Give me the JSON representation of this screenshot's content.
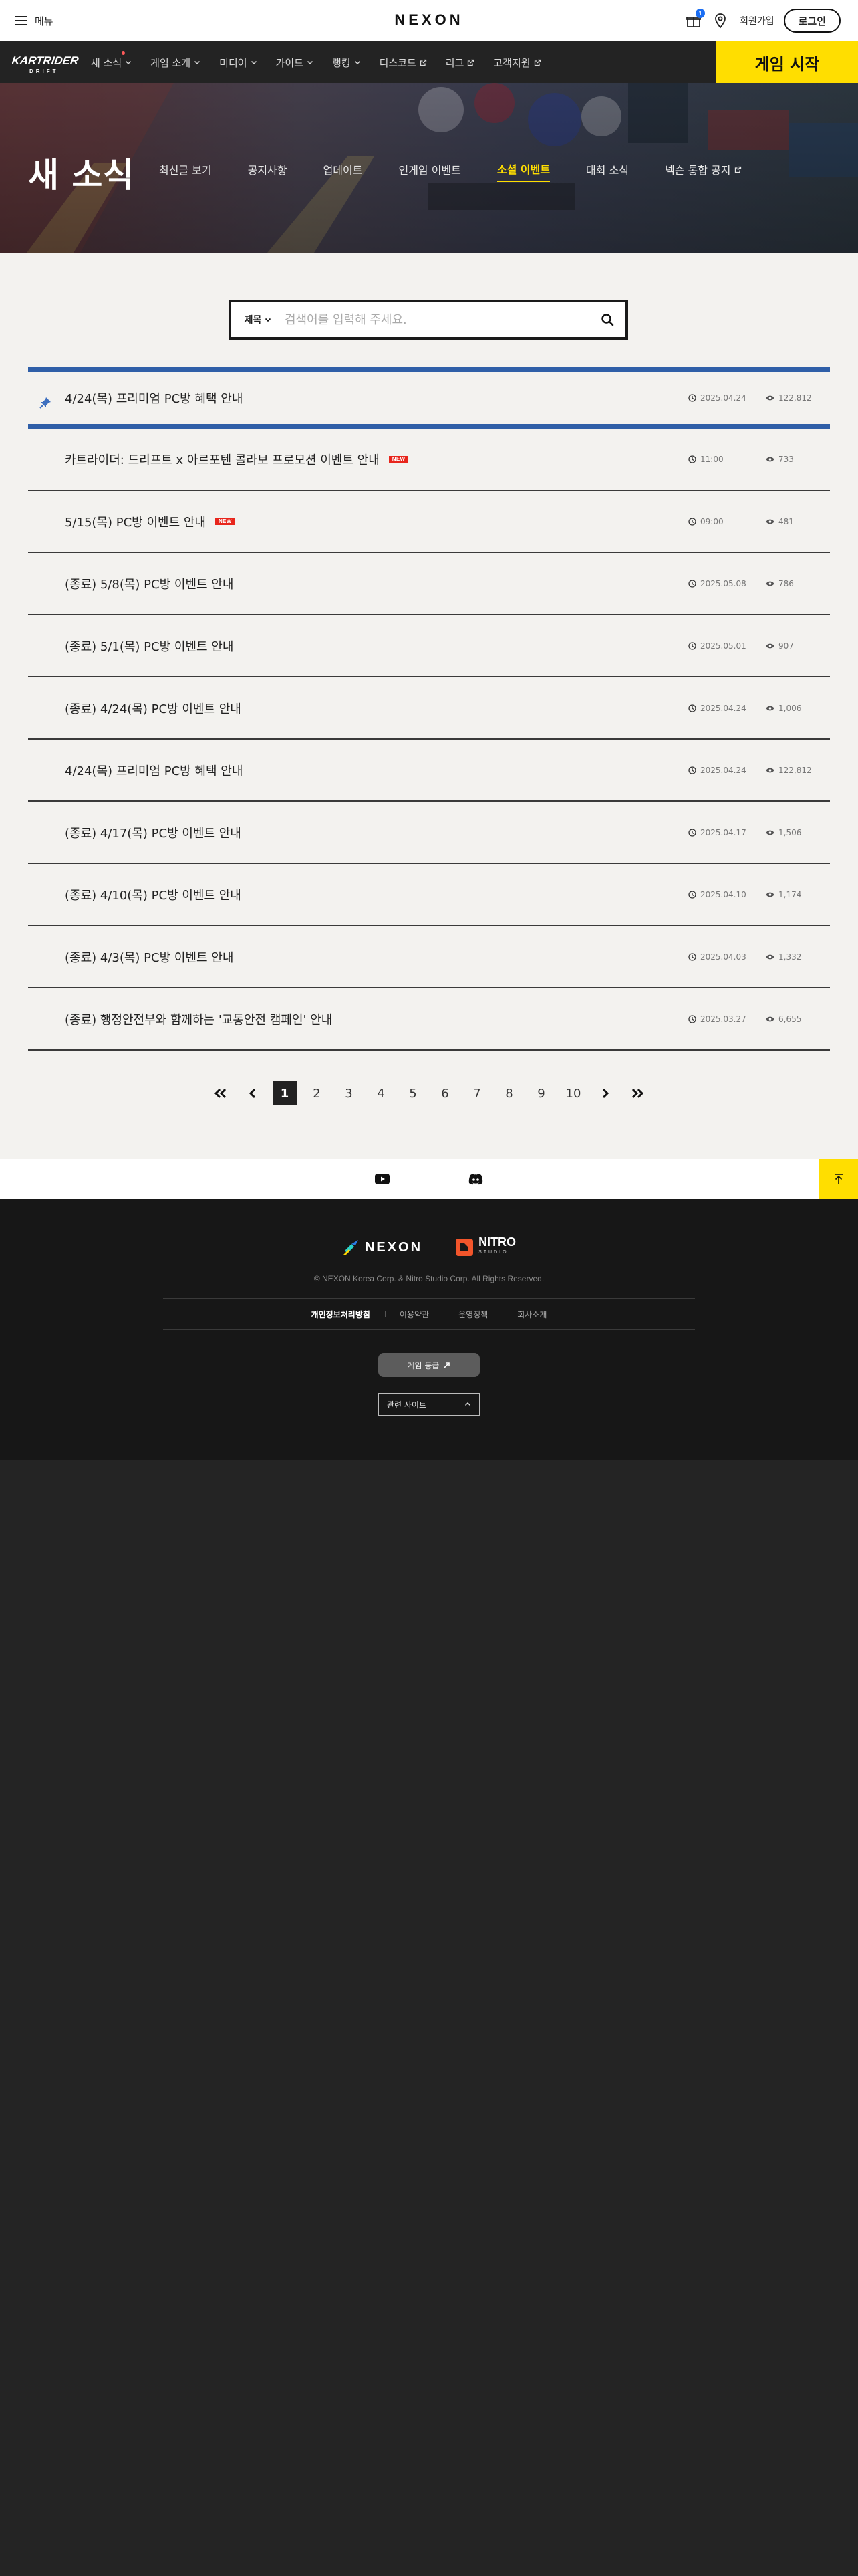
{
  "topbar": {
    "menu_label": "메뉴",
    "logo_text": "NEXON",
    "notification_count": "1",
    "signup_label": "회원가입",
    "login_label": "로그인"
  },
  "gamenav": {
    "logo_text": "KARTRIDER",
    "logo_sub": "DRIFT",
    "items": [
      {
        "label": "새 소식",
        "icon": "chevron-down",
        "dot": true
      },
      {
        "label": "게임 소개",
        "icon": "chevron-down"
      },
      {
        "label": "미디어",
        "icon": "chevron-down"
      },
      {
        "label": "가이드",
        "icon": "chevron-down"
      },
      {
        "label": "랭킹",
        "icon": "chevron-down"
      },
      {
        "label": "디스코드",
        "icon": "external-link"
      },
      {
        "label": "리그",
        "icon": "external-link"
      },
      {
        "label": "고객지원",
        "icon": "external-link"
      }
    ],
    "game_start_label": "게임 시작"
  },
  "hero": {
    "title": "새 소식",
    "tabs": [
      {
        "label": "최신글 보기"
      },
      {
        "label": "공지사항"
      },
      {
        "label": "업데이트"
      },
      {
        "label": "인게임 이벤트"
      },
      {
        "label": "소셜 이벤트",
        "active": true
      },
      {
        "label": "대회 소식"
      },
      {
        "label": "넥슨 통합 공지",
        "external": true
      }
    ]
  },
  "search": {
    "filter_label": "제목",
    "placeholder": "검색어를 입력해 주세요.",
    "value": ""
  },
  "posts": {
    "pinned": {
      "title": "4/24(목) 프리미엄 PC방 혜택 안내",
      "date": "2025.04.24",
      "views": "122,812"
    },
    "items": [
      {
        "title": "카트라이더: 드리프트 x 아르포텐 콜라보 프로모션 이벤트 안내",
        "date": "11:00",
        "views": "733",
        "new": true
      },
      {
        "title": "5/15(목) PC방 이벤트 안내",
        "date": "09:00",
        "views": "481",
        "new": true
      },
      {
        "title": "(종료) 5/8(목) PC방 이벤트 안내",
        "date": "2025.05.08",
        "views": "786"
      },
      {
        "title": "(종료) 5/1(목) PC방 이벤트 안내",
        "date": "2025.05.01",
        "views": "907"
      },
      {
        "title": "(종료) 4/24(목) PC방 이벤트 안내",
        "date": "2025.04.24",
        "views": "1,006"
      },
      {
        "title": "4/24(목) 프리미엄 PC방 혜택 안내",
        "date": "2025.04.24",
        "views": "122,812"
      },
      {
        "title": "(종료) 4/17(목) PC방 이벤트 안내",
        "date": "2025.04.17",
        "views": "1,506"
      },
      {
        "title": "(종료) 4/10(목) PC방 이벤트 안내",
        "date": "2025.04.10",
        "views": "1,174"
      },
      {
        "title": "(종료) 4/3(목) PC방 이벤트 안내",
        "date": "2025.04.03",
        "views": "1,332"
      },
      {
        "title": "(종료) 행정안전부와 함께하는 '교통안전 캠페인' 안내",
        "date": "2025.03.27",
        "views": "6,655"
      }
    ],
    "new_badge": "NEW"
  },
  "pagination": {
    "pages": [
      "1",
      "2",
      "3",
      "4",
      "5",
      "6",
      "7",
      "8",
      "9",
      "10"
    ],
    "current": "1"
  },
  "social": {
    "icons": [
      "youtube-icon",
      "discord-icon"
    ]
  },
  "footer": {
    "nexon_logo": "NEXON",
    "nitro_logo": "NITRO",
    "nitro_sub": "STUDIO",
    "copyright": "© NEXON Korea Corp. & Nitro Studio Corp. All Rights Reserved.",
    "links": [
      {
        "label": "개인정보처리방침",
        "bold": true
      },
      {
        "label": "이용약관"
      },
      {
        "label": "운영정책"
      },
      {
        "label": "회사소개"
      }
    ],
    "grade_label": "게임 등급",
    "family_site_label": "관련 사이트"
  },
  "colors": {
    "accent_yellow": "#ffde00",
    "pin_blue": "#2f5fa8",
    "new_red": "#e8261c",
    "nav_bg": "#232323",
    "footer_bg": "#171717"
  }
}
